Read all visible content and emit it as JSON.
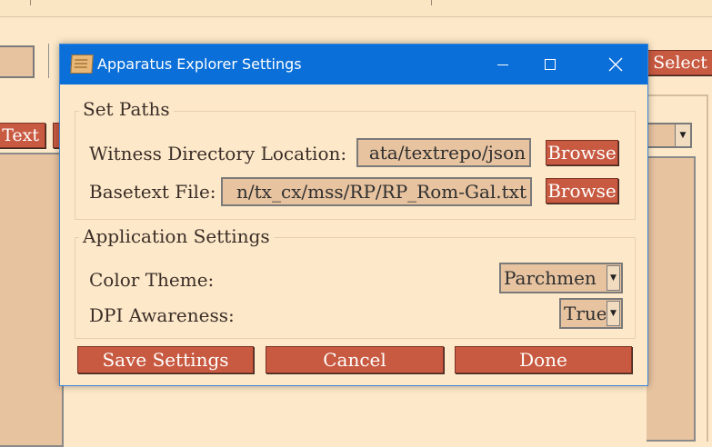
{
  "window": {
    "title": "Apparatus Explorer Settings",
    "icon": "parchment-icon",
    "controls": {
      "minimize_icon": "minimize-icon",
      "maximize_icon": "maximize-icon",
      "close_icon": "close-icon"
    }
  },
  "background": {
    "select_label": "Select",
    "text_label": "Text"
  },
  "paths": {
    "group_title": "Set Paths",
    "witness_label": "Witness Directory Location:",
    "witness_value": "ata/textrepo/json",
    "basetext_label": "Basetext File:",
    "basetext_value": "n/tx_cx/mss/RP/RP_Rom-Gal.txt",
    "browse_label": "Browse"
  },
  "app_settings": {
    "group_title": "Application Settings",
    "color_theme_label": "Color Theme:",
    "color_theme_value": "Parchmen",
    "dpi_label": "DPI Awareness:",
    "dpi_value": "True"
  },
  "actions": {
    "save_label": "Save Settings",
    "cancel_label": "Cancel",
    "done_label": "Done"
  },
  "colors": {
    "titlebar": "#0a6fd8",
    "button": "#c85a41",
    "background": "#fde9c9",
    "field": "#e7c3a0"
  }
}
